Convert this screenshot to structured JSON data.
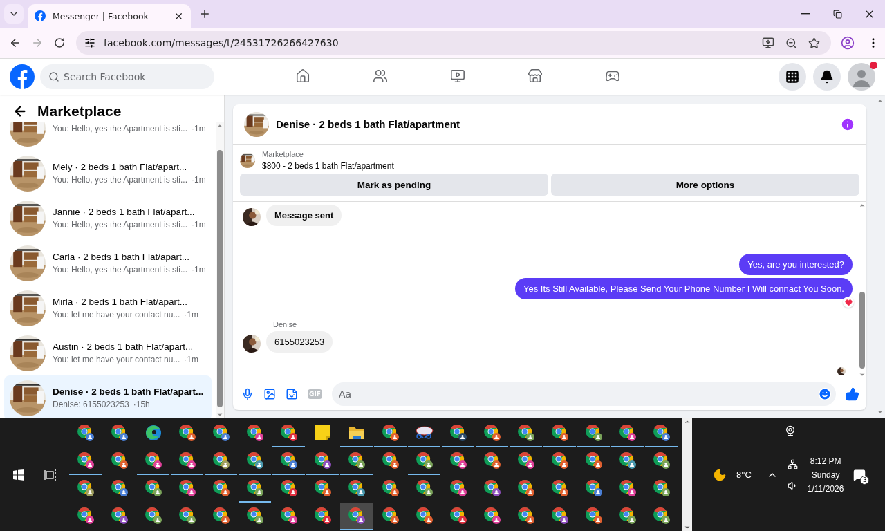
{
  "browser": {
    "tab": {
      "title": "Messenger | Facebook",
      "selected": true
    },
    "url": "facebook.com/messages/t/24531726266427630"
  },
  "facebook_nav": {
    "search": {
      "placeholder": "Search Facebook"
    },
    "items": [
      {
        "kind": "home",
        "selected": false
      },
      {
        "kind": "friends",
        "selected": false
      },
      {
        "kind": "video",
        "selected": false
      },
      {
        "kind": "marketplace",
        "selected": false
      },
      {
        "kind": "gaming",
        "selected": false
      }
    ],
    "notification_dot": true
  },
  "sidebar": {
    "title": "Marketplace",
    "chats": [
      {
        "preview": "You: Hello, yes the Apartment is sti...",
        "time": "·1m",
        "selected": false
      },
      {
        "name": "Mely · 2 beds 1 bath Flat/apart...",
        "preview": "You: Hello, yes the Apartment is sti...",
        "time": "·1m",
        "selected": false
      },
      {
        "name": "Jannie · 2 beds 1 bath Flat/apart...",
        "preview": "You: Hello, yes the Apartment is sti...",
        "time": "·1m",
        "selected": false
      },
      {
        "name": "Carla · 2 beds 1 bath Flat/apart...",
        "preview": "You: Hello, yes the Apartment is sti...",
        "time": "·1m",
        "selected": false
      },
      {
        "name": "Mirla · 2 beds 1 bath Flat/apart...",
        "preview": "You: let me have your contact nu...",
        "time": "·1m",
        "selected": false
      },
      {
        "name": "Austin · 2 beds 1 bath Flat/apart...",
        "preview": "You: let me have your contact nu...",
        "time": "·1m",
        "selected": false
      },
      {
        "name": "Denise · 2 beds 1 bath Flat/apart...",
        "preview": "Denise: 6155023253",
        "time": "·15h",
        "selected": true
      }
    ]
  },
  "conversation": {
    "title": "Denise · 2 beds 1 bath Flat/apartment",
    "listing": {
      "label": "Marketplace",
      "title": "$800 - 2 beds 1 bath Flat/apartment"
    },
    "buttons": [
      "Mark as pending",
      "More options"
    ],
    "messages": [
      {
        "kind": "received",
        "text": "Message sent",
        "bold": true
      },
      {
        "kind": "sent",
        "text": "Yes, are you interested?",
        "reaction": false
      },
      {
        "kind": "sent",
        "text": "Yes Its Still Available, Please Send Your Phone Number I Will connact You Soon.",
        "reaction": true
      },
      {
        "kind": "received",
        "sender": "Denise",
        "text": "6155023253",
        "bold": false
      }
    ],
    "composer": {
      "placeholder": "Aa",
      "gif_label": "GIF"
    }
  },
  "taskbar": {
    "rows": [
      [
        {
          "kind": "chrome",
          "color": "#4a7fd6",
          "running": false,
          "selected": false
        },
        {
          "kind": "chrome",
          "color": "#4a7fd6",
          "running": false,
          "selected": false
        },
        {
          "kind": "edge",
          "running": false,
          "selected": false
        },
        {
          "kind": "chrome",
          "color": "#e06030",
          "running": false,
          "selected": false
        },
        {
          "kind": "chrome",
          "color": "#4a7fd6",
          "running": false,
          "selected": false
        },
        {
          "kind": "chrome",
          "color": "#e0409a",
          "running": false,
          "selected": false
        },
        {
          "kind": "chrome",
          "color": "#e03040",
          "running": true,
          "selected": false
        },
        {
          "kind": "sticky",
          "running": false,
          "selected": false
        },
        {
          "kind": "folder",
          "running": true,
          "selected": false
        },
        {
          "kind": "chrome",
          "color": "#e06030",
          "running": true,
          "selected": false
        },
        {
          "kind": "snip",
          "running": true,
          "selected": false
        },
        {
          "kind": "chrome",
          "color": "#2a4a6a",
          "running": true,
          "selected": false
        },
        {
          "kind": "chrome",
          "color": "#e06030",
          "running": true,
          "selected": false
        },
        {
          "kind": "chrome",
          "color": "#7aa35a",
          "running": true,
          "selected": false
        },
        {
          "kind": "chrome",
          "color": "#e06030",
          "running": true,
          "selected": false
        },
        {
          "kind": "chrome",
          "color": "#7aa35a",
          "running": true,
          "selected": false
        },
        {
          "kind": "chrome",
          "color": "#e0409a",
          "running": true,
          "selected": false
        },
        {
          "kind": "chrome",
          "color": "#4a7fd6",
          "running": true,
          "selected": false
        }
      ],
      [
        {
          "kind": "chrome",
          "color": "#e0409a",
          "running": true,
          "selected": false
        },
        {
          "kind": "chrome",
          "color": "#e06030",
          "running": false,
          "selected": false
        },
        {
          "kind": "chrome",
          "color": "#e0409a",
          "running": true,
          "selected": false
        },
        {
          "kind": "chrome",
          "color": "#e0409a",
          "running": true,
          "selected": false
        },
        {
          "kind": "chrome",
          "color": "#a0a060",
          "running": true,
          "selected": false
        },
        {
          "kind": "chrome",
          "color": "#4a9ab0",
          "running": true,
          "selected": false
        },
        {
          "kind": "chrome",
          "color": "#4a7fd6",
          "running": true,
          "selected": false
        },
        {
          "kind": "chrome",
          "color": "#9050c0",
          "running": true,
          "selected": false
        },
        {
          "kind": "chrome",
          "color": "#7aa35a",
          "running": true,
          "selected": false
        },
        {
          "kind": "chrome",
          "color": "#e06030",
          "running": false,
          "selected": false
        },
        {
          "kind": "chrome",
          "color": "#7aa35a",
          "running": true,
          "selected": false
        },
        {
          "kind": "chrome",
          "color": "#e0409a",
          "running": false,
          "selected": false
        },
        {
          "kind": "chrome",
          "color": "#e06030",
          "running": false,
          "selected": false
        },
        {
          "kind": "chrome",
          "color": "#e0409a",
          "running": false,
          "selected": false
        },
        {
          "kind": "chrome",
          "color": "#e06030",
          "running": false,
          "selected": false
        },
        {
          "kind": "chrome",
          "color": "#e06030",
          "running": false,
          "selected": false
        },
        {
          "kind": "chrome",
          "color": "#4a9ab0",
          "running": false,
          "selected": false
        },
        {
          "kind": "chrome",
          "color": "#7aa35a",
          "running": false,
          "selected": false
        }
      ],
      [
        {
          "kind": "chrome",
          "color": "#a0a060",
          "running": false,
          "selected": false
        },
        {
          "kind": "chrome",
          "color": "#4a7fd6",
          "running": false,
          "selected": false
        },
        {
          "kind": "chrome",
          "color": "#7aa35a",
          "running": false,
          "selected": false
        },
        {
          "kind": "chrome",
          "color": "#e0409a",
          "running": false,
          "selected": false
        },
        {
          "kind": "chrome",
          "color": "#e06030",
          "running": false,
          "selected": false
        },
        {
          "kind": "chrome",
          "color": "#7aa35a",
          "running": true,
          "selected": false
        },
        {
          "kind": "chrome",
          "color": "#e03040",
          "running": false,
          "selected": false
        },
        {
          "kind": "chrome",
          "color": "#e06030",
          "running": false,
          "selected": false
        },
        {
          "kind": "chrome",
          "color": "#4a9ab0",
          "running": false,
          "selected": false
        },
        {
          "kind": "chrome",
          "color": "#e06030",
          "running": false,
          "selected": false
        },
        {
          "kind": "chrome",
          "color": "#7aa35a",
          "running": false,
          "selected": false
        },
        {
          "kind": "chrome",
          "color": "#e0409a",
          "running": false,
          "selected": false
        },
        {
          "kind": "chrome",
          "color": "#9050c0",
          "running": false,
          "selected": false
        },
        {
          "kind": "chrome",
          "color": "#e06030",
          "running": false,
          "selected": false
        },
        {
          "kind": "chrome",
          "color": "#e06030",
          "running": false,
          "selected": false
        },
        {
          "kind": "chrome",
          "color": "#4a7fd6",
          "running": false,
          "selected": false
        },
        {
          "kind": "chrome",
          "color": "#e0409a",
          "running": false,
          "selected": false
        },
        {
          "kind": "chrome",
          "color": "#7aa35a",
          "running": false,
          "selected": false
        }
      ],
      [
        {
          "kind": "chrome",
          "color": "#e0409a",
          "running": false,
          "selected": false
        },
        {
          "kind": "chrome",
          "color": "#9050c0",
          "running": false,
          "selected": false
        },
        {
          "kind": "chrome",
          "color": "#7aa35a",
          "running": false,
          "selected": false
        },
        {
          "kind": "chrome",
          "color": "#7aa35a",
          "running": false,
          "selected": false
        },
        {
          "kind": "chrome",
          "color": "#e06030",
          "running": false,
          "selected": false
        },
        {
          "kind": "chrome",
          "color": "#7aa35a",
          "running": false,
          "selected": false
        },
        {
          "kind": "chrome",
          "color": "#e0409a",
          "running": false,
          "selected": false
        },
        {
          "kind": "chrome",
          "color": "#e03040",
          "running": false,
          "selected": false
        },
        {
          "kind": "chrome",
          "color": "#9050c0",
          "running": true,
          "selected": true
        },
        {
          "kind": "chrome",
          "color": "#e06030",
          "running": false,
          "selected": false
        },
        {
          "kind": "chrome",
          "color": "#e06030",
          "running": false,
          "selected": false
        },
        {
          "kind": "chrome",
          "color": "#e03040",
          "running": false,
          "selected": false
        },
        {
          "kind": "chrome",
          "color": "#e0409a",
          "running": false,
          "selected": false
        },
        {
          "kind": "chrome",
          "color": "#e06030",
          "running": false,
          "selected": false
        },
        {
          "kind": "chrome",
          "color": "#9050c0",
          "running": false,
          "selected": false
        },
        {
          "kind": "chrome",
          "color": "#e06030",
          "running": false,
          "selected": false
        },
        {
          "kind": "chrome",
          "color": "#7aa35a",
          "running": false,
          "selected": false
        },
        {
          "kind": "chrome",
          "color": "#7aa35a",
          "running": false,
          "selected": false
        }
      ]
    ],
    "weather": "8°C",
    "time": "8:12 PM",
    "day": "Sunday",
    "date": "1/11/2026",
    "notifications": "3"
  }
}
